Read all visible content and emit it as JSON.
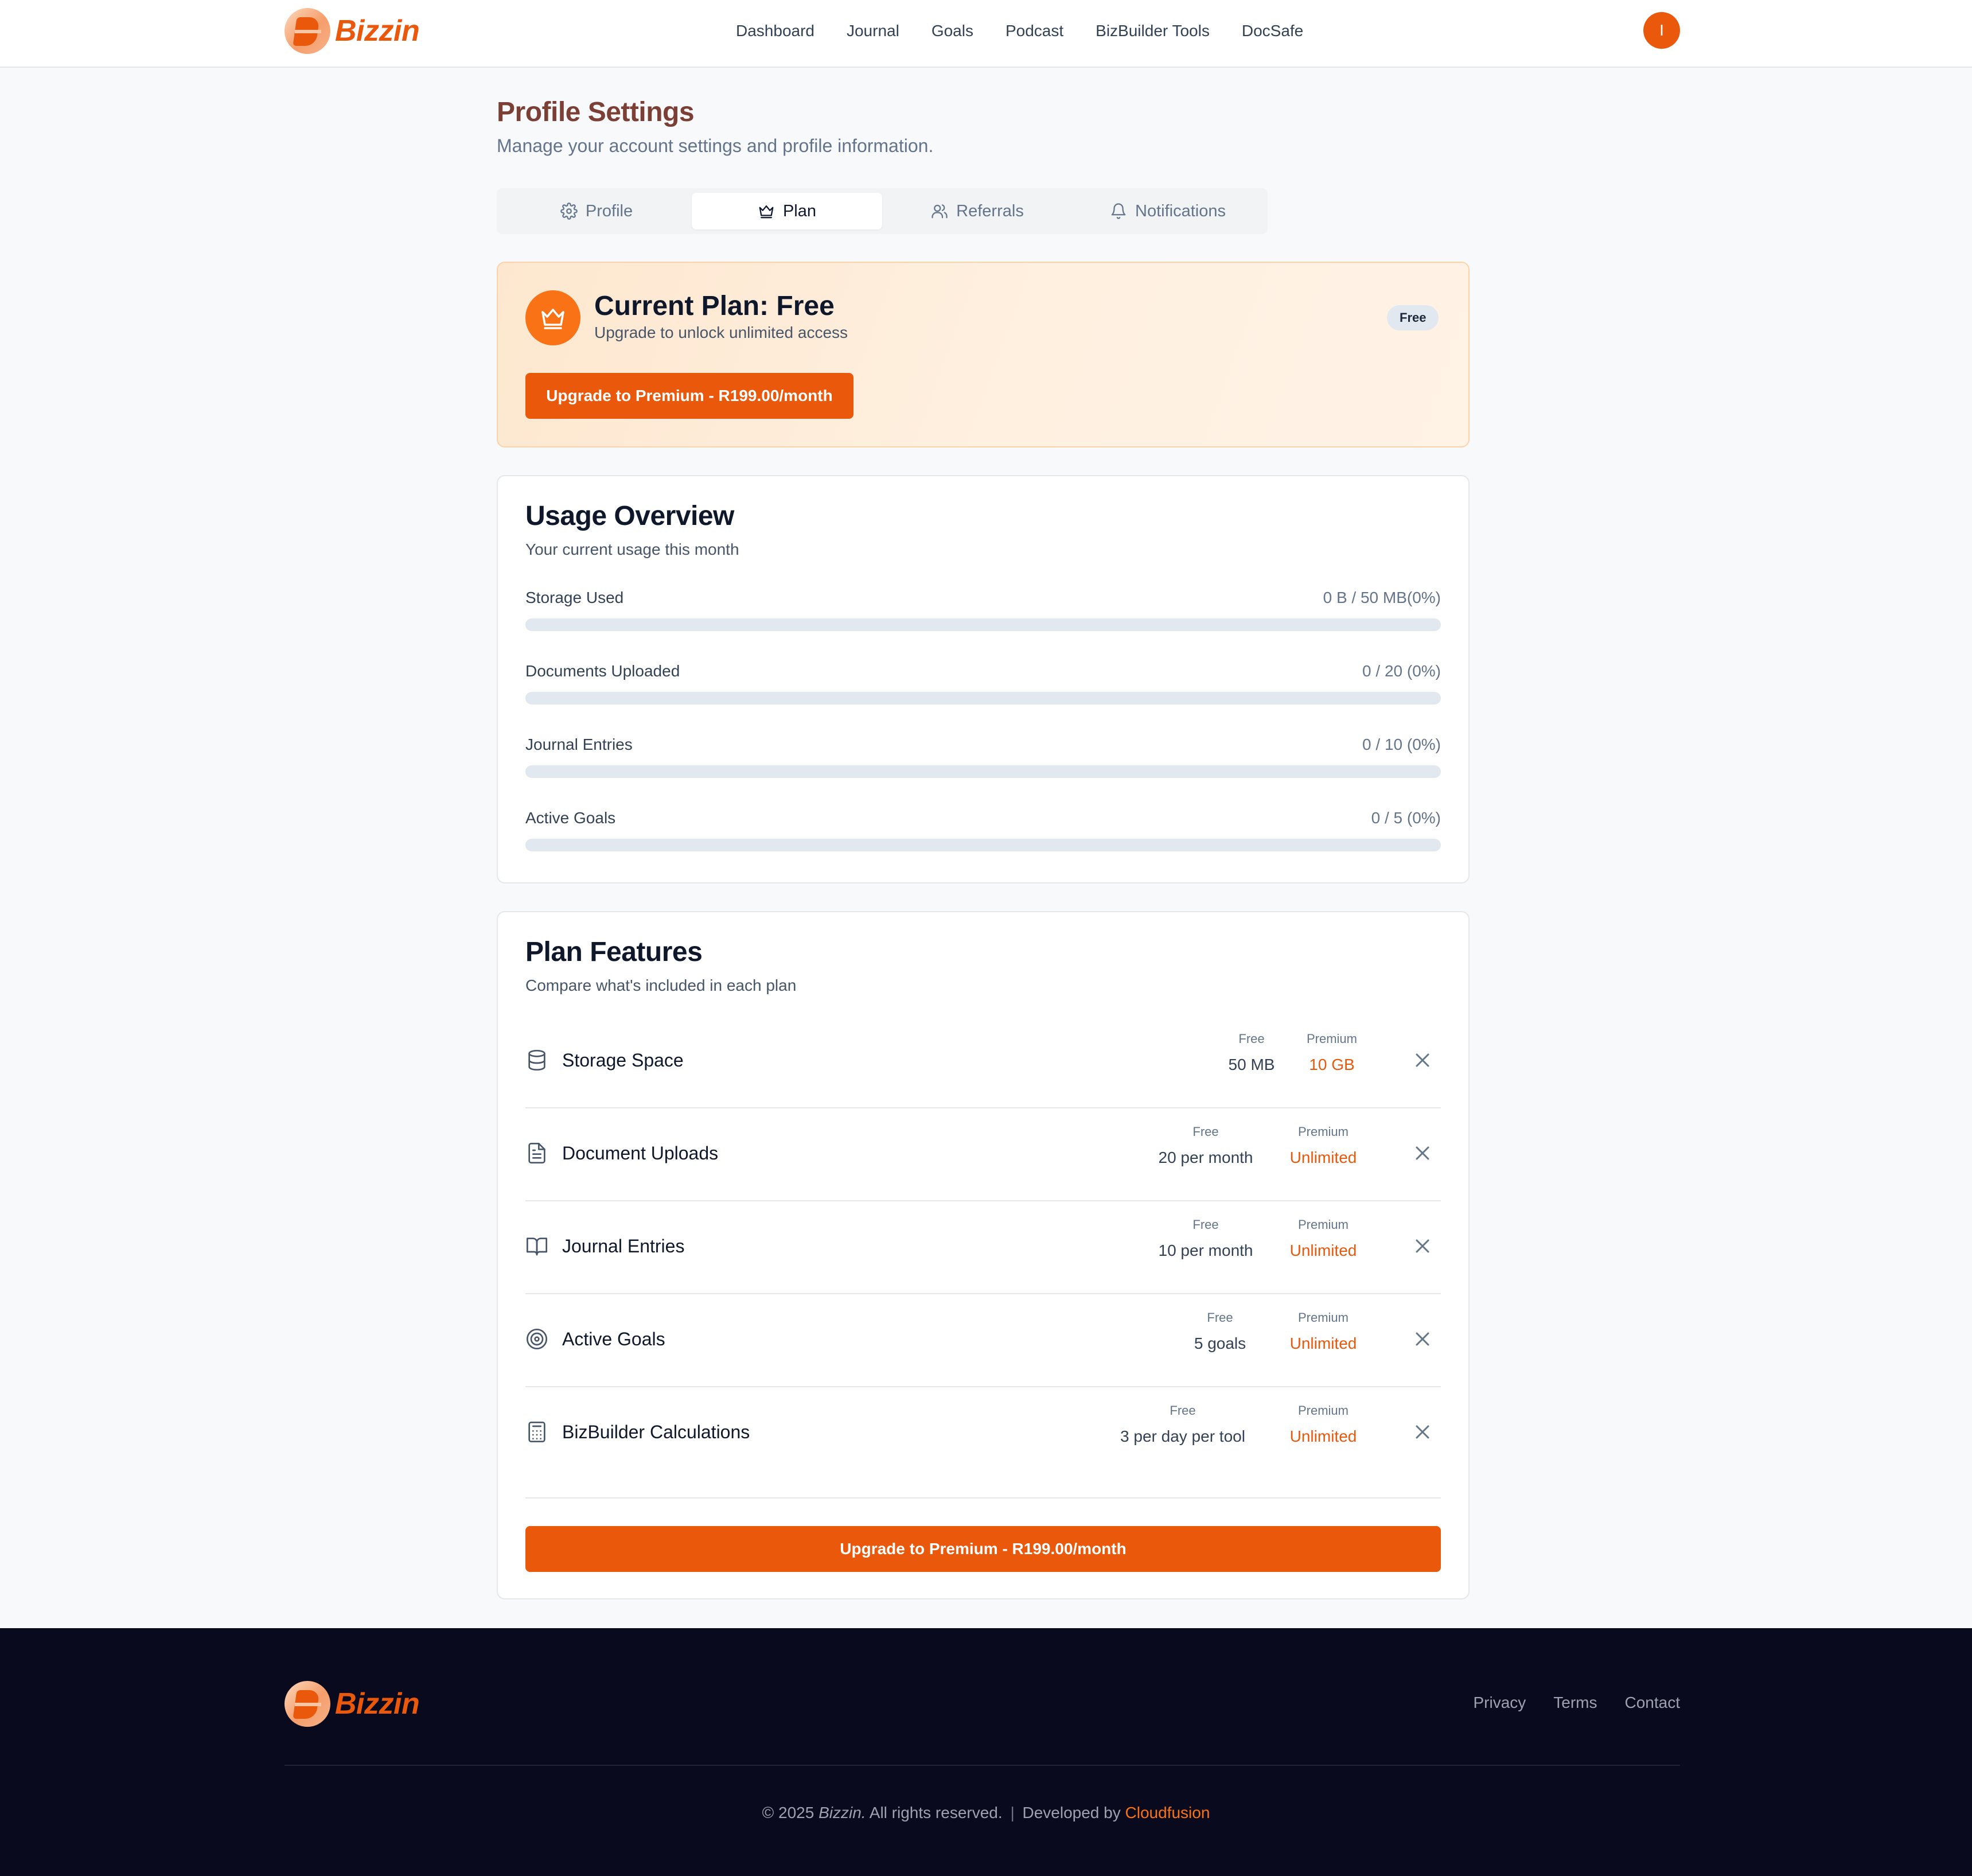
{
  "header": {
    "brand": "Bizzin",
    "nav": [
      "Dashboard",
      "Journal",
      "Goals",
      "Podcast",
      "BizBuilder Tools",
      "DocSafe"
    ],
    "avatar_initial": "I"
  },
  "page": {
    "title": "Profile Settings",
    "subtitle": "Manage your account settings and profile information."
  },
  "tabs": [
    {
      "label": "Profile",
      "icon": "gear-icon",
      "active": false
    },
    {
      "label": "Plan",
      "icon": "crown-icon",
      "active": true
    },
    {
      "label": "Referrals",
      "icon": "users-icon",
      "active": false
    },
    {
      "label": "Notifications",
      "icon": "bell-icon",
      "active": false
    }
  ],
  "current_plan": {
    "title": "Current Plan: Free",
    "subtitle": "Upgrade to unlock unlimited access",
    "badge": "Free",
    "upgrade_button": "Upgrade to Premium - R199.00/month"
  },
  "usage": {
    "title": "Usage Overview",
    "subtitle": "Your current usage this month",
    "items": [
      {
        "label": "Storage Used",
        "value": "0 B / 50 MB(0%)",
        "percent": 0
      },
      {
        "label": "Documents Uploaded",
        "value": "0 / 20 (0%)",
        "percent": 0
      },
      {
        "label": "Journal Entries",
        "value": "0 / 10 (0%)",
        "percent": 0
      },
      {
        "label": "Active Goals",
        "value": "0 / 5 (0%)",
        "percent": 0
      }
    ]
  },
  "features": {
    "title": "Plan Features",
    "subtitle": "Compare what's included in each plan",
    "free_header": "Free",
    "premium_header": "Premium",
    "items": [
      {
        "name": "Storage Space",
        "icon": "database-icon",
        "free": "50 MB",
        "premium": "10 GB"
      },
      {
        "name": "Document Uploads",
        "icon": "document-icon",
        "free": "20 per month",
        "premium": "Unlimited"
      },
      {
        "name": "Journal Entries",
        "icon": "book-icon",
        "free": "10 per month",
        "premium": "Unlimited"
      },
      {
        "name": "Active Goals",
        "icon": "target-icon",
        "free": "5 goals",
        "premium": "Unlimited"
      },
      {
        "name": "BizBuilder Calculations",
        "icon": "calculator-icon",
        "free": "3 per day per tool",
        "premium": "Unlimited"
      }
    ],
    "upgrade_button": "Upgrade to Premium - R199.00/month"
  },
  "footer": {
    "brand": "Bizzin",
    "links": [
      "Privacy",
      "Terms",
      "Contact"
    ],
    "copyright_prefix": "© 2025",
    "copyright_brand": "Bizzin.",
    "copyright_rest": "All rights reserved.",
    "separator": "|",
    "developed_by": "Developed by",
    "developer": "Cloudfusion"
  },
  "colors": {
    "accent": "#ea580c",
    "title": "#7c3f36",
    "footer_bg": "#0a0a1e"
  }
}
